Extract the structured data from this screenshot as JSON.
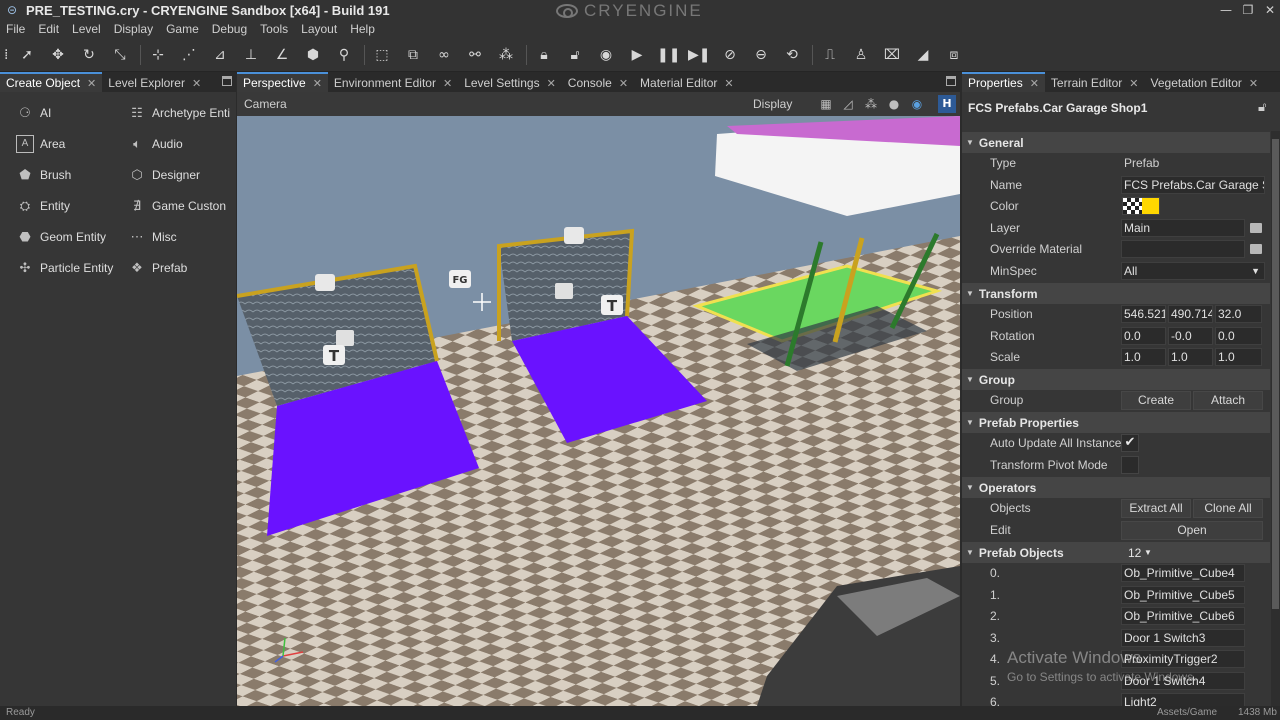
{
  "window": {
    "title": "PRE_TESTING.cry - CRYENGINE Sandbox [x64] - Build 191",
    "brand": "CRYENGINE"
  },
  "menu": [
    "File",
    "Edit",
    "Level",
    "Display",
    "Game",
    "Debug",
    "Tools",
    "Layout",
    "Help"
  ],
  "toolbar_icons": [
    "select-arrow-icon",
    "move-icon",
    "rotate-icon",
    "scale-icon",
    "snap-grid-icon",
    "snap-terrain-icon",
    "snap-object-icon",
    "align-icon",
    "snap-angle-icon",
    "goto-icon",
    "zoom-icon",
    "select-box-icon",
    "select-region-icon",
    "link-icon",
    "unlink-icon",
    "ai-point-icon",
    "lock-icon",
    "unlock-icon",
    "record-icon",
    "play-icon",
    "pause-icon",
    "step-icon",
    "physics-icon",
    "ai-physics-icon",
    "sync-icon",
    "terrain-icon",
    "character-icon",
    "prefab-icon",
    "vegetation-icon",
    "tool-icon"
  ],
  "left_panel": {
    "tabs": [
      {
        "label": "Create Object",
        "active": true
      },
      {
        "label": "Level Explorer",
        "active": false
      }
    ],
    "create_objects": [
      {
        "label": "AI",
        "icon": "ai-icon"
      },
      {
        "label": "Archetype Enti",
        "icon": "archetype-icon"
      },
      {
        "label": "Area",
        "icon": "area-icon"
      },
      {
        "label": "Audio",
        "icon": "audio-icon"
      },
      {
        "label": "Brush",
        "icon": "brush-icon"
      },
      {
        "label": "Designer",
        "icon": "designer-icon"
      },
      {
        "label": "Entity",
        "icon": "entity-icon"
      },
      {
        "label": "Game Custon",
        "icon": "game-custom-icon"
      },
      {
        "label": "Geom Entity",
        "icon": "geom-entity-icon"
      },
      {
        "label": "Misc",
        "icon": "misc-icon"
      },
      {
        "label": "Particle Entity",
        "icon": "particle-icon"
      },
      {
        "label": "Prefab",
        "icon": "prefab-icon"
      }
    ]
  },
  "viewport": {
    "tabs": [
      {
        "label": "Perspective",
        "active": true
      },
      {
        "label": "Environment Editor",
        "active": false
      },
      {
        "label": "Level Settings",
        "active": false
      },
      {
        "label": "Console",
        "active": false
      },
      {
        "label": "Material Editor",
        "active": false
      }
    ],
    "camera_label": "Camera",
    "display_label": "Display",
    "h_button": "H",
    "scene_labels": {
      "fg": "FG",
      "t": "T"
    }
  },
  "properties": {
    "tabs": [
      {
        "label": "Properties",
        "active": true
      },
      {
        "label": "Terrain Editor",
        "active": false
      },
      {
        "label": "Vegetation Editor",
        "active": false
      }
    ],
    "object_path": "FCS Prefabs.Car Garage Shop1",
    "sections": {
      "general": "General",
      "transform": "Transform",
      "group": "Group",
      "prefab_props": "Prefab Properties",
      "operators": "Operators",
      "prefab_objects": "Prefab Objects"
    },
    "general": {
      "type_label": "Type",
      "type_value": "Prefab",
      "name_label": "Name",
      "name_value": "FCS Prefabs.Car Garage S",
      "color_label": "Color",
      "color_value": "#ffd700",
      "layer_label": "Layer",
      "layer_value": "Main",
      "override_label": "Override Material",
      "override_value": "",
      "minspec_label": "MinSpec",
      "minspec_value": "All"
    },
    "transform": {
      "position_label": "Position",
      "position": [
        "546.521",
        "490.714",
        "32.0"
      ],
      "rotation_label": "Rotation",
      "rotation": [
        "0.0",
        "-0.0",
        "0.0"
      ],
      "scale_label": "Scale",
      "scale": [
        "1.0",
        "1.0",
        "1.0"
      ]
    },
    "group": {
      "label": "Group",
      "create": "Create",
      "attach": "Attach"
    },
    "prefab_props": {
      "auto_update_label": "Auto Update All Instance",
      "auto_update_checked": true,
      "pivot_label": "Transform Pivot Mode",
      "pivot_checked": false
    },
    "operators": {
      "objects_label": "Objects",
      "extract_all": "Extract All",
      "clone_all": "Clone All",
      "edit_label": "Edit",
      "open": "Open"
    },
    "prefab_objects": {
      "count": "12",
      "items": [
        {
          "index": "0.",
          "name": "Ob_Primitive_Cube4"
        },
        {
          "index": "1.",
          "name": "Ob_Primitive_Cube5"
        },
        {
          "index": "2.",
          "name": "Ob_Primitive_Cube6"
        },
        {
          "index": "3.",
          "name": "Door 1 Switch3"
        },
        {
          "index": "4.",
          "name": "ProximityTrigger2"
        },
        {
          "index": "5.",
          "name": "Door 1 Switch4"
        },
        {
          "index": "6.",
          "name": "Light2"
        }
      ]
    }
  },
  "status": {
    "ready": "Ready",
    "assets": "Assets/Game",
    "memory": "1438 Mb"
  },
  "watermark": {
    "title": "Activate Windows",
    "subtitle": "Go to Settings to activate Windows."
  }
}
